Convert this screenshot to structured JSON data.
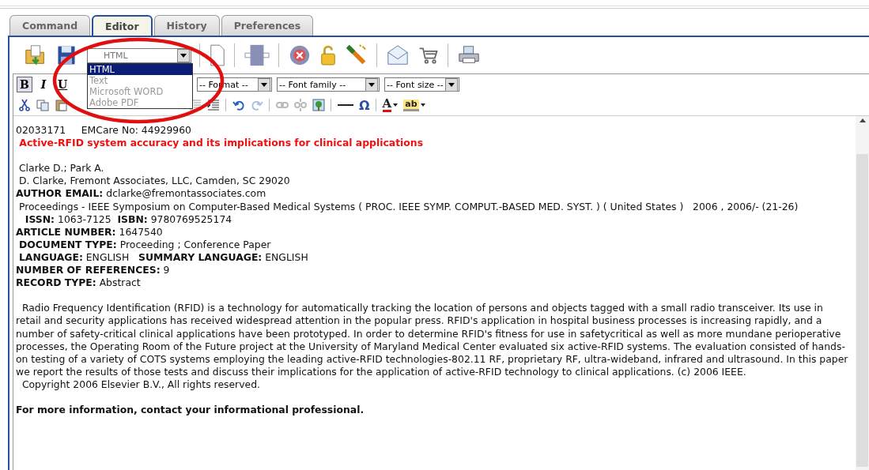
{
  "tabs": [
    {
      "label": "Command",
      "selected": false
    },
    {
      "label": "Editor",
      "selected": true
    },
    {
      "label": "History",
      "selected": false
    },
    {
      "label": "Preferences",
      "selected": false
    }
  ],
  "doc_type": {
    "value": "HTML",
    "expanded": true,
    "options": [
      {
        "label": "HTML",
        "selected": true,
        "disabled": false
      },
      {
        "label": "Text",
        "selected": false,
        "disabled": true
      },
      {
        "label": "Microsoft WORD",
        "selected": false,
        "disabled": true
      },
      {
        "label": "Adobe PDF",
        "selected": false,
        "disabled": true
      }
    ]
  },
  "format_buttons": [
    {
      "label": "B",
      "kind": "bold",
      "on": true
    },
    {
      "label": "I",
      "kind": "italic",
      "on": false
    },
    {
      "label": "U",
      "kind": "underline",
      "on": false
    }
  ],
  "format_selects": [
    "-- Format --",
    "-- Font family --",
    "-- Font size --"
  ],
  "edit_glyphs": {
    "symbol": "Ω",
    "font_color": "A",
    "highlight": "ab"
  },
  "document": [
    {
      "kind": "plain",
      "text": "02033171     EMCare No: 44929960"
    },
    {
      "kind": "title",
      "text": " Active-RFID system accuracy and its implications for clinical applications"
    },
    {
      "kind": "blank"
    },
    {
      "kind": "plain",
      "text": " Clarke D.; Park A."
    },
    {
      "kind": "plain",
      "text": " D. Clarke, Fremont Associates, LLC, Camden, SC 29020"
    },
    {
      "kind": "plain",
      "text": "**AUTHOR EMAIL:** dclarke@fremontassociates.com"
    },
    {
      "kind": "plain",
      "text": " Proceedings - IEEE Symposium on Computer-Based Medical Systems ( PROC. IEEE SYMP. COMPUT.-BASED MED. SYST. ) ( United States )   2006 , 2006/- (21-26)"
    },
    {
      "kind": "plain",
      "text": "   **ISSN:** 1063-7125  **ISBN:** 9780769525174"
    },
    {
      "kind": "plain",
      "text": "**ARTICLE NUMBER:** 1647540"
    },
    {
      "kind": "plain",
      "text": " **DOCUMENT TYPE:** Proceeding ; Conference Paper"
    },
    {
      "kind": "plain",
      "text": " **LANGUAGE:** ENGLISH   **SUMMARY LANGUAGE:** ENGLISH"
    },
    {
      "kind": "plain",
      "text": "**NUMBER OF REFERENCES:** 9"
    },
    {
      "kind": "plain",
      "text": "**RECORD TYPE:** Abstract"
    },
    {
      "kind": "blank"
    },
    {
      "kind": "plain",
      "text": "  Radio Frequency Identification (RFID) is a technology for automatically tracking the location of persons and objects tagged with a small radio transceiver. Its use in retail and security applications has received widespread attention in the popular press. RFID's application in hospital business processes is increasing rapidly, and a number of safety-critical clinical applications have been prototyped. In order to determine RFID's fitness for use in safetycritical as well as more mundane perioperative processes, the Operating Room of the Future project at the University of Maryland Medical Center evaluated six active-RFID systems. The evaluation consisted of hands-on testing of a variety of COTS systems employing the leading active-RFID technologies-802.11 RF, proprietary RF, ultra-wideband, infrared and ultrasound. In this paper we report the results of those tests and discuss their implications for the application of active-RFID technology to clinical applications. (c) 2006 IEEE."
    },
    {
      "kind": "plain",
      "text": "  Copyright 2006 Elsevier B.V., All rights reserved."
    },
    {
      "kind": "blank"
    },
    {
      "kind": "bold",
      "text": "For more information, contact your informational professional."
    }
  ]
}
